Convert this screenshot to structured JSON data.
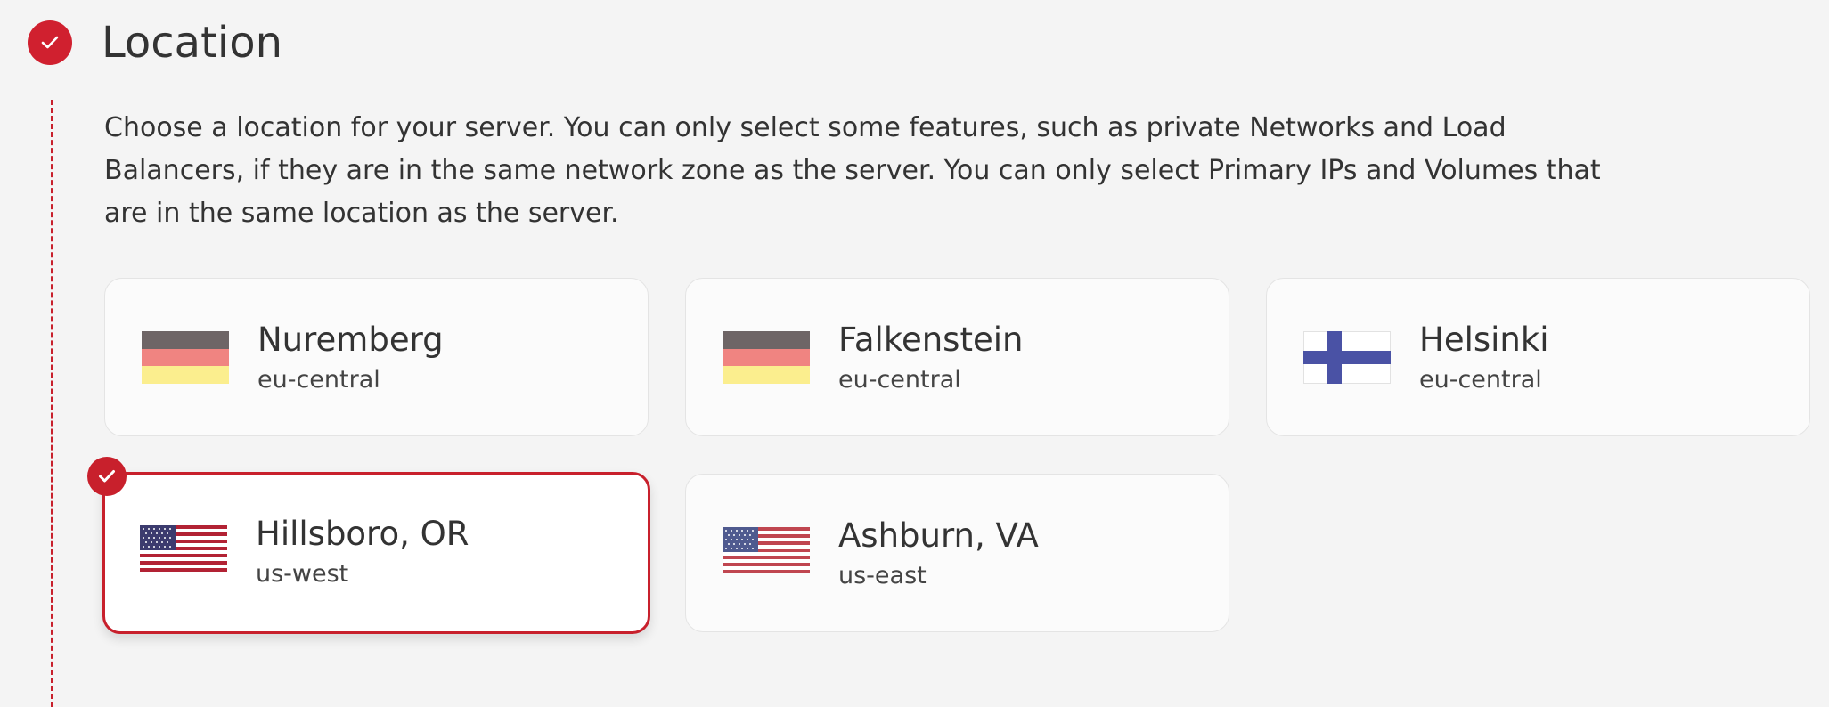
{
  "step": {
    "title": "Location",
    "status_icon": "check-icon",
    "accent_color": "#c8202c"
  },
  "description": "Choose a location for your server. You can only select some features, such as private Networks and Load Balancers, if they are in the same network zone as the server. You can only select Primary IPs and Volumes that are in the same location as the server.",
  "locations": [
    {
      "name": "Nuremberg",
      "zone": "eu-central",
      "flag": "germany-flag-icon",
      "selected": false
    },
    {
      "name": "Falkenstein",
      "zone": "eu-central",
      "flag": "germany-flag-icon",
      "selected": false
    },
    {
      "name": "Helsinki",
      "zone": "eu-central",
      "flag": "finland-flag-icon",
      "selected": false
    },
    {
      "name": "Hillsboro, OR",
      "zone": "us-west",
      "flag": "usa-flag-icon",
      "selected": true
    },
    {
      "name": "Ashburn, VA",
      "zone": "us-east",
      "flag": "usa-flag-icon",
      "selected": false
    }
  ]
}
